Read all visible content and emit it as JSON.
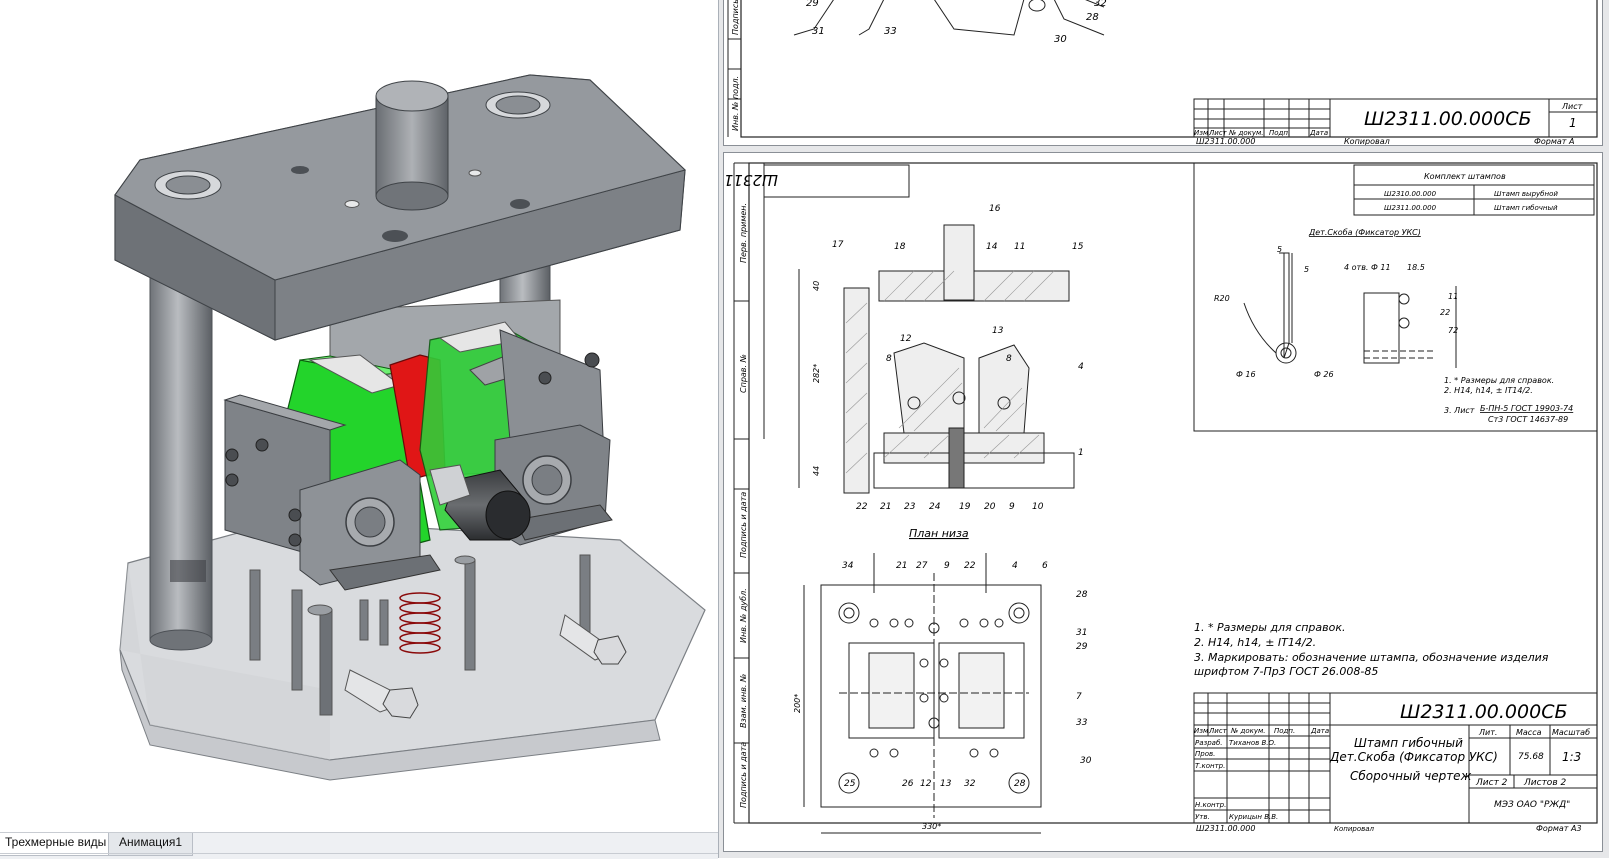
{
  "tabs": [
    {
      "label": "Трехмерные виды",
      "active": true
    },
    {
      "label": "Анимация1",
      "active": false
    }
  ],
  "sheet1": {
    "designation": "Ш2311.00.000СБ",
    "sheet_label": "Лист",
    "sheet_no": "1",
    "copied": "Копировал",
    "format": "Формат А",
    "bottom_code": "Ш2311.00.000",
    "balloons": [
      "31",
      "33",
      "30",
      "28",
      "32",
      "29"
    ],
    "header_cells": [
      "Изм",
      "Лист",
      "№ докум.",
      "Подп.",
      "Дата"
    ],
    "side_labels": [
      "Подпись и дата",
      "Инв. № подл."
    ]
  },
  "sheet2": {
    "top_mirror_code": "Ш2311.00.000СБ",
    "side_labels": [
      "Перв. примен.",
      "Справ. №",
      "Подпись и дата",
      "Инв. № дубл.",
      "Взам. инв. №",
      "Подпись и дата",
      "Инв. № подл."
    ],
    "kit_title": "Комплект штампов",
    "kit_rows": [
      {
        "code": "Ш2310.00.000",
        "name": "Штамп вырубной"
      },
      {
        "code": "Ш2311.00.000",
        "name": "Штамп гибочный"
      }
    ],
    "part_title": "Дет.Скоба (Фиксатор УКС)",
    "part_dims": [
      "5",
      "5",
      "4 отв. Ф 11",
      "18.5",
      "11",
      "22",
      "72",
      "R20",
      "Ф 16",
      "Ф 26"
    ],
    "part_notes": [
      "1. * Размеры для справок.",
      "2. H14, h14, ± IT14/2.",
      "3. Лист",
      "Б-ПН-5 ГОСТ 19903-74",
      "Ст3 ГОСТ 14637-89"
    ],
    "section_balloons": [
      "16",
      "17",
      "18",
      "14",
      "11",
      "15",
      "12",
      "13",
      "8",
      "8",
      "4",
      "1",
      "22",
      "21",
      "23",
      "24",
      "19",
      "20",
      "9",
      "10"
    ],
    "section_dims": [
      "40",
      "282*",
      "44"
    ],
    "plan_title": "План низа",
    "plan_balloons": [
      "34",
      "21",
      "27",
      "9",
      "22",
      "4",
      "6",
      "28",
      "31",
      "29",
      "7",
      "33",
      "30",
      "25",
      "26",
      "12",
      "13",
      "32",
      "28"
    ],
    "plan_dims": [
      "200*",
      "330*"
    ],
    "notes": [
      "1. * Размеры для справок.",
      "2. H14, h14, ± IT14/2.",
      "3. Маркировать: обозначение штампа, обозначение изделия",
      "шрифтом 7-Пр3 ГОСТ 26.008-85"
    ],
    "title_block": {
      "designation": "Ш2311.00.000СБ",
      "name_line1": "Штамп гибочный",
      "name_line2": "Дет.Скоба (Фиксатор УКС)",
      "name_line3": "Сборочный чертеж",
      "lit_label": "Лит.",
      "mass_label": "Масса",
      "scale_label": "Масштаб",
      "mass": "75.68",
      "scale": "1:3",
      "sheet": "Лист 2",
      "sheets": "Листов 2",
      "org": "МЭЗ ОАО \"РЖД\"",
      "rows": [
        "Изм",
        "Лист",
        "№ докум.",
        "Подп.",
        "Дата"
      ],
      "roles": [
        "Разраб.",
        "Пров.",
        "Т.контр.",
        "Н.контр.",
        "Утв."
      ],
      "developer": "Тиханов В.О.",
      "approver": "Курицын В.В.",
      "bottom_code": "Ш2311.00.000",
      "copied": "Копировал",
      "format": "Формат А3"
    }
  },
  "colors": {
    "green_part": "#22d32b",
    "red_part": "#e01515",
    "steel": "#8f9398",
    "steel_dark": "#5d6166",
    "glass": "#d4d6da"
  }
}
